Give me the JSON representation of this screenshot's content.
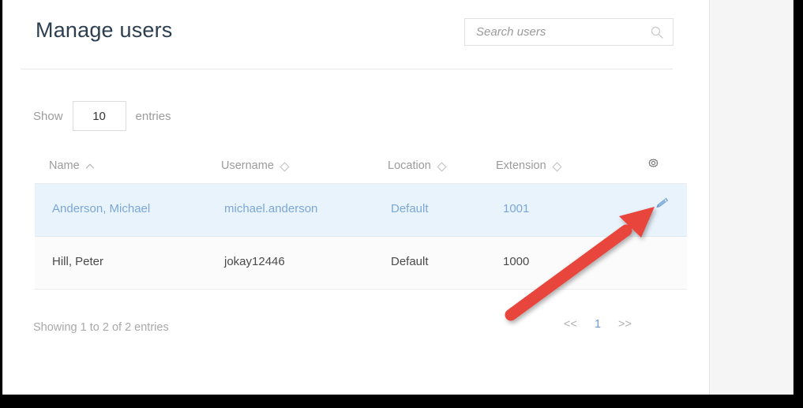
{
  "header": {
    "title": "Manage users"
  },
  "search": {
    "placeholder": "Search users",
    "value": "",
    "icon": "search-icon"
  },
  "controls": {
    "show_label": "Show",
    "entries_value": "10",
    "entries_label": "entries"
  },
  "table": {
    "columns": [
      {
        "label": "Name",
        "sort": "asc",
        "sort_icon": "chevron-up-icon"
      },
      {
        "label": "Username",
        "sort": "none",
        "sort_icon": "diamond-sort-icon"
      },
      {
        "label": "Location",
        "sort": "none",
        "sort_icon": "diamond-sort-icon"
      },
      {
        "label": "Extension",
        "sort": "none",
        "sort_icon": "diamond-sort-icon"
      }
    ],
    "settings_icon": "gear-icon",
    "rows": [
      {
        "name": "Anderson, Michael",
        "username": "michael.anderson",
        "location": "Default",
        "extension": "1001",
        "action_icon": "pencil-edit-icon",
        "selected": true
      },
      {
        "name": "Hill, Peter",
        "username": "jokay12446",
        "location": "Default",
        "extension": "1000",
        "action_icon": "",
        "selected": false
      }
    ]
  },
  "footer": {
    "info": "Showing 1 to 2 of 2 entries",
    "pagination": {
      "prev": "<<",
      "pages": [
        "1"
      ],
      "next": ">>",
      "active": "1"
    }
  },
  "annotation": {
    "type": "arrow",
    "color": "#e8453c",
    "points_to": "pencil-edit-icon"
  },
  "colors": {
    "title": "#2c3e50",
    "row_highlight_bg": "#e9f3fc",
    "row_highlight_text": "#7ba7d7",
    "accent_link": "#6c9bd4",
    "annotation_red": "#e8453c",
    "muted_text": "#9b9b9b"
  }
}
